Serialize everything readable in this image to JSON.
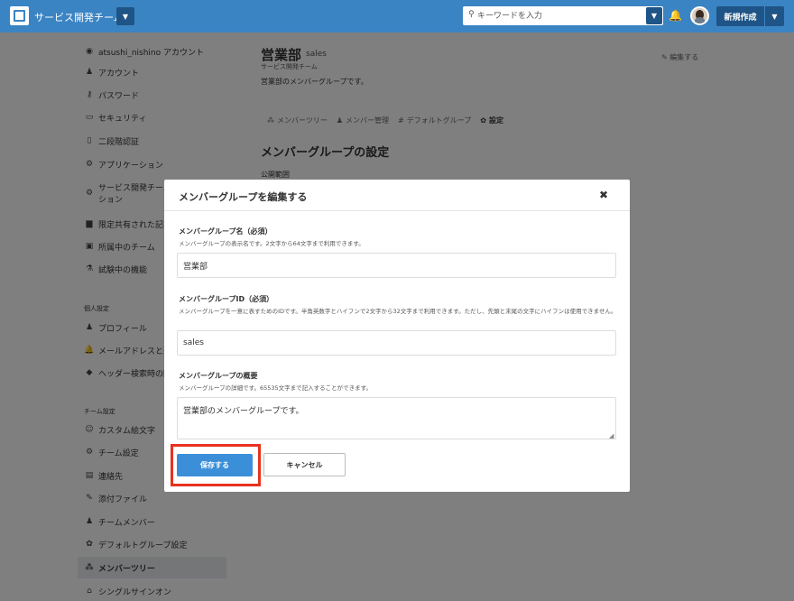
{
  "header": {
    "team_name": "サービス開発チーム",
    "search_placeholder": "キーワードを入力",
    "new_button": "新規作成",
    "colors": {
      "bar": "#3b84c3",
      "dark": "#1f5487"
    }
  },
  "sidebar": {
    "account": [
      {
        "icon": "user-circle-icon",
        "glyph": "◉",
        "label": "atsushi_nishino アカウント"
      },
      {
        "icon": "user-icon",
        "glyph": "♟",
        "label": "アカウント"
      },
      {
        "icon": "key-icon",
        "glyph": "⚷",
        "label": "パスワード"
      },
      {
        "icon": "monitor-icon",
        "glyph": "▭",
        "label": "セキュリティ"
      },
      {
        "icon": "phone-icon",
        "glyph": "▯",
        "label": "二段階認証"
      },
      {
        "icon": "apps-icon",
        "glyph": "⚙",
        "label": "アプリケーション"
      },
      {
        "icon": "apps-icon",
        "glyph": "⚙",
        "label": "サービス開発チーム"
      },
      {
        "icon": "apps-continued",
        "glyph": "",
        "label": "ション"
      },
      {
        "icon": "file-icon",
        "glyph": "▆",
        "label": "限定共有された記事"
      },
      {
        "icon": "id-card-icon",
        "glyph": "▣",
        "label": "所属中のチーム"
      },
      {
        "icon": "flask-icon",
        "glyph": "⚗",
        "label": "試験中の機能"
      }
    ],
    "personal_heading": "個人設定",
    "personal": [
      {
        "icon": "user-icon",
        "glyph": "♟",
        "label": "プロフィール"
      },
      {
        "icon": "bell-icon",
        "glyph": "🔔",
        "label": "メールアドレスと通知"
      },
      {
        "icon": "tag-icon",
        "glyph": "◆",
        "label": "ヘッダー検索時の除外"
      }
    ],
    "team_heading": "チーム設定",
    "team": [
      {
        "icon": "smile-icon",
        "glyph": "☺",
        "label": "カスタム絵文字"
      },
      {
        "icon": "gears-icon",
        "glyph": "⚙",
        "label": "チーム設定"
      },
      {
        "icon": "contact-card-icon",
        "glyph": "▤",
        "label": "連絡先"
      },
      {
        "icon": "paperclip-icon",
        "glyph": "✎",
        "label": "添付ファイル"
      },
      {
        "icon": "users-icon",
        "glyph": "♟",
        "label": "チームメンバー"
      },
      {
        "icon": "gear-icon",
        "glyph": "✿",
        "label": "デフォルトグループ設定"
      },
      {
        "icon": "sitemap-icon",
        "glyph": "⁂",
        "label": "メンバーツリー"
      },
      {
        "icon": "bank-icon",
        "glyph": "⌂",
        "label": "シングルサインオン"
      }
    ]
  },
  "main": {
    "title": "営業部",
    "slug": "sales",
    "team": "サービス開発チーム",
    "description": "営業部のメンバーグループです。",
    "edit_label": "編集する",
    "tabs": [
      {
        "icon": "sitemap-icon",
        "glyph": "⁂",
        "label": "メンバーツリー"
      },
      {
        "icon": "user-icon",
        "glyph": "♟",
        "label": "メンバー管理"
      },
      {
        "icon": "hash-icon",
        "glyph": "#",
        "label": "デフォルトグループ"
      },
      {
        "icon": "gear-icon",
        "glyph": "✿",
        "label": "設定"
      }
    ],
    "section_title": "メンバーグループの設定",
    "section_sub": "公開範囲"
  },
  "modal": {
    "title": "メンバーグループを編集する",
    "close": "✖",
    "name_label": "メンバーグループ名（必須）",
    "name_help": "メンバーグループの表示名です。2文字から64文字まで利用できます。",
    "name_value": "営業部",
    "id_label": "メンバーグループID（必須）",
    "id_help": "メンバーグループを一意に表すためのIDです。半角英数字とハイフンで2文字から32文字まで利用できます。ただし、先頭と末尾の文字にハイフンは使用できません。",
    "id_value": "sales",
    "desc_label": "メンバーグループの概要",
    "desc_help": "メンバーグループの詳細です。65535文字まで記入することができます。",
    "desc_value": "営業部のメンバーグループです。",
    "save": "保存する",
    "cancel": "キャンセル",
    "highlight_color": "#e8321e"
  }
}
